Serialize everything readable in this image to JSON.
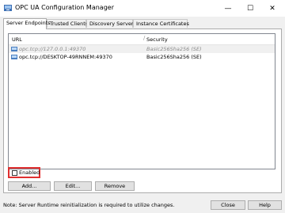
{
  "window": {
    "title": "OPC UA Configuration Manager"
  },
  "titlebar_buttons": {
    "minimize": "—",
    "maximize": "☐",
    "close": "✕"
  },
  "tabs": [
    {
      "label": "Server Endpoints"
    },
    {
      "label": "Trusted Clients"
    },
    {
      "label": "Discovery Servers"
    },
    {
      "label": "Instance Certificates"
    }
  ],
  "endpoints": {
    "columns": {
      "url": "URL",
      "security": "Security"
    },
    "rows": [
      {
        "url": "opc.tcp://127.0.0.1:49370",
        "security": "Basic256Sha256 (SE)"
      },
      {
        "url": "opc.tcp://DESKTOP-49RNNEM:49370",
        "security": "Basic256Sha256 (SE)"
      }
    ]
  },
  "enabled": {
    "label": "Enabled"
  },
  "buttons": {
    "add": "Add...",
    "edit": "Edit...",
    "remove": "Remove",
    "close": "Close",
    "help": "Help"
  },
  "status": {
    "note": "Note: Server Runtime reinitialization is required to utilize changes."
  }
}
